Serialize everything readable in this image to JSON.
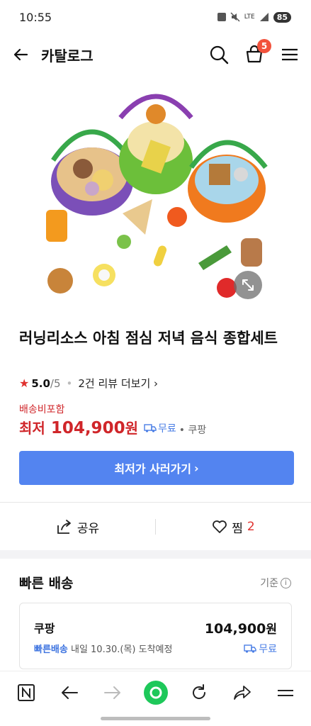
{
  "status_bar": {
    "time": "10:55",
    "network": "LTE",
    "battery": "85"
  },
  "header": {
    "title": "카탈로그",
    "cart_count": "5"
  },
  "product": {
    "title": "러닝리소스 아침 점심 저녁 음식 종합세트",
    "rating_score": "5.0",
    "rating_max": "/5",
    "review_link": "2건 리뷰 더보기",
    "shipping_note": "배송비포함",
    "lowest_label": "최저",
    "price": "104,900",
    "won": "원",
    "free_shipping": "무료",
    "mall": "쿠팡",
    "buy_button": "최저가 사러가기"
  },
  "actions": {
    "share_label": "공유",
    "wish_label": "찜",
    "wish_count": "2"
  },
  "fast_delivery": {
    "title": "빠른 배송",
    "basis": "기준",
    "offer": {
      "mall": "쿠팡",
      "price": "104,900",
      "won": "원",
      "fast_label": "빠른배송",
      "arrival": "내일 10.30.(목) 도착예정",
      "free": "무료"
    }
  },
  "colors": {
    "accent_blue": "#5384f0",
    "price_red": "#d0262a",
    "badge_red": "#f2523c",
    "free_blue": "#4a7ee5"
  },
  "icons": [
    "back-arrow-icon",
    "search-icon",
    "cart-icon",
    "menu-icon",
    "expand-icon",
    "share-icon",
    "heart-icon",
    "truck-icon",
    "info-icon",
    "naver-n-icon",
    "nav-back-icon",
    "nav-forward-icon",
    "home-green-icon",
    "refresh-icon",
    "nav-share-icon",
    "nav-menu-icon"
  ]
}
